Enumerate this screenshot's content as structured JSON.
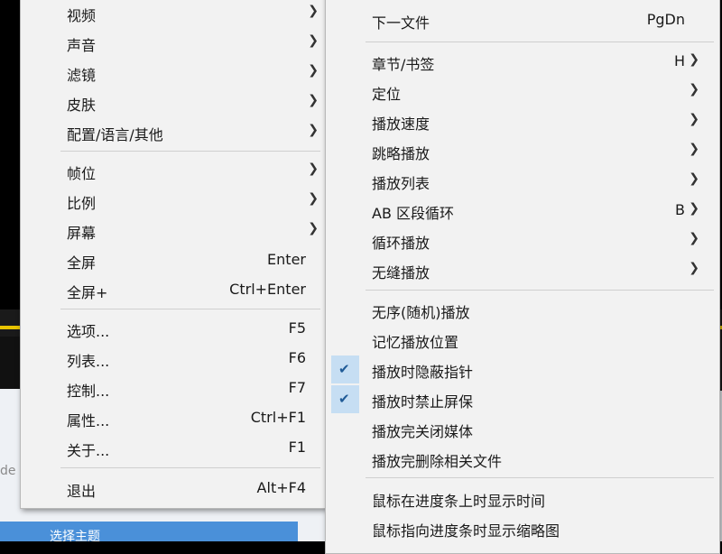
{
  "background": {
    "edge_text": "de",
    "blue_bar_text": "选择主题"
  },
  "left_menu": {
    "items": [
      {
        "label": "视频",
        "shortcut": "",
        "submenu": true
      },
      {
        "label": "声音",
        "shortcut": "",
        "submenu": true
      },
      {
        "label": "滤镜",
        "shortcut": "",
        "submenu": true
      },
      {
        "label": "皮肤",
        "shortcut": "",
        "submenu": true
      },
      {
        "label": "配置/语言/其他",
        "shortcut": "",
        "submenu": true
      },
      {
        "label": "帧位",
        "shortcut": "",
        "submenu": true
      },
      {
        "label": "比例",
        "shortcut": "",
        "submenu": true
      },
      {
        "label": "屏幕",
        "shortcut": "",
        "submenu": true
      },
      {
        "label": "全屏",
        "shortcut": "Enter",
        "submenu": false
      },
      {
        "label": "全屏+",
        "shortcut": "Ctrl+Enter",
        "submenu": false
      },
      {
        "label": "选项...",
        "shortcut": "F5",
        "submenu": false
      },
      {
        "label": "列表...",
        "shortcut": "F6",
        "submenu": false
      },
      {
        "label": "控制...",
        "shortcut": "F7",
        "submenu": false
      },
      {
        "label": "属性...",
        "shortcut": "Ctrl+F1",
        "submenu": false
      },
      {
        "label": "关于...",
        "shortcut": "F1",
        "submenu": false
      },
      {
        "label": "退出",
        "shortcut": "Alt+F4",
        "submenu": false
      }
    ]
  },
  "right_menu": {
    "items": [
      {
        "label": "下一文件",
        "shortcut": "PgDn",
        "submenu": false,
        "checked": false
      },
      {
        "label": "章节/书签",
        "shortcut": "H",
        "submenu": true,
        "checked": false
      },
      {
        "label": "定位",
        "shortcut": "",
        "submenu": true,
        "checked": false
      },
      {
        "label": "播放速度",
        "shortcut": "",
        "submenu": true,
        "checked": false
      },
      {
        "label": "跳略播放",
        "shortcut": "",
        "submenu": true,
        "checked": false
      },
      {
        "label": "播放列表",
        "shortcut": "",
        "submenu": true,
        "checked": false
      },
      {
        "label": "AB 区段循环",
        "shortcut": "B",
        "submenu": true,
        "checked": false
      },
      {
        "label": "循环播放",
        "shortcut": "",
        "submenu": true,
        "checked": false
      },
      {
        "label": "无缝播放",
        "shortcut": "",
        "submenu": true,
        "checked": false
      },
      {
        "label": "无序(随机)播放",
        "shortcut": "",
        "submenu": false,
        "checked": false
      },
      {
        "label": "记忆播放位置",
        "shortcut": "",
        "submenu": false,
        "checked": false
      },
      {
        "label": "播放时隐蔽指针",
        "shortcut": "",
        "submenu": false,
        "checked": true
      },
      {
        "label": "播放时禁止屏保",
        "shortcut": "",
        "submenu": false,
        "checked": true
      },
      {
        "label": "播放完关闭媒体",
        "shortcut": "",
        "submenu": false,
        "checked": false
      },
      {
        "label": "播放完删除相关文件",
        "shortcut": "",
        "submenu": false,
        "checked": false
      },
      {
        "label": "鼠标在进度条上时显示时间",
        "shortcut": "",
        "submenu": false,
        "checked": false
      },
      {
        "label": "鼠标指向进度条时显示缩略图",
        "shortcut": "",
        "submenu": false,
        "checked": false
      }
    ]
  },
  "icons": {
    "submenu_arrow": "chevron-right-icon",
    "checkmark": "check-icon"
  }
}
